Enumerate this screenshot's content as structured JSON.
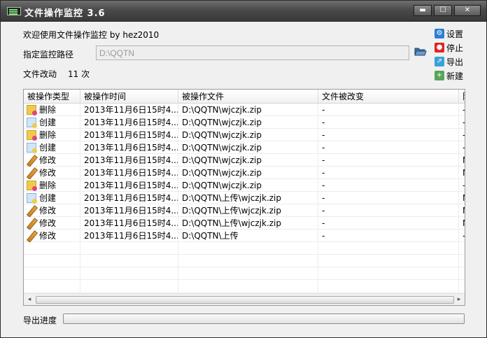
{
  "window": {
    "title": "文件操作监控 3.6",
    "minimize_glyph": "▬",
    "maximize_glyph": "☐",
    "close_glyph": "✕"
  },
  "welcome": "欢迎使用文件操作监控 by hez2010",
  "path": {
    "label": "指定监控路径",
    "value": "D:\\QQTN"
  },
  "count": {
    "label": "文件改动",
    "value": "11 次"
  },
  "side_buttons": [
    {
      "label": "设置",
      "icon": "gear-icon",
      "color": "#2d7fd3",
      "glyph": "⚙"
    },
    {
      "label": "停止",
      "icon": "stop-icon",
      "color": "#e02424",
      "glyph": "●"
    },
    {
      "label": "导出",
      "icon": "export-icon",
      "color": "#3aa0d9",
      "glyph": "⇗"
    },
    {
      "label": "新建",
      "icon": "new-file-icon",
      "color": "#5aa35a",
      "glyph": "+"
    }
  ],
  "table": {
    "columns": [
      "被操作类型",
      "被操作时间",
      "被操作文件",
      "文件被改变",
      "附"
    ],
    "rows": [
      {
        "type": "删除",
        "icon": "delete-icon",
        "time": "2013年11月6日15时4...",
        "file": "D:\\QQTN\\wjczjk.zip",
        "changed": "-",
        "extra": "-"
      },
      {
        "type": "创建",
        "icon": "create-icon",
        "time": "2013年11月6日15时4...",
        "file": "D:\\QQTN\\wjczjk.zip",
        "changed": "-",
        "extra": "-"
      },
      {
        "type": "删除",
        "icon": "delete-icon",
        "time": "2013年11月6日15时4...",
        "file": "D:\\QQTN\\wjczjk.zip",
        "changed": "-",
        "extra": "-"
      },
      {
        "type": "创建",
        "icon": "create-icon",
        "time": "2013年11月6日15时4...",
        "file": "D:\\QQTN\\wjczjk.zip",
        "changed": "-",
        "extra": "-"
      },
      {
        "type": "修改",
        "icon": "modify-icon",
        "time": "2013年11月6日15时4...",
        "file": "D:\\QQTN\\wjczjk.zip",
        "changed": "-",
        "extra": "N"
      },
      {
        "type": "修改",
        "icon": "modify-icon",
        "time": "2013年11月6日15时4...",
        "file": "D:\\QQTN\\wjczjk.zip",
        "changed": "-",
        "extra": "N"
      },
      {
        "type": "删除",
        "icon": "delete-icon",
        "time": "2013年11月6日15时4...",
        "file": "D:\\QQTN\\wjczjk.zip",
        "changed": "-",
        "extra": "-"
      },
      {
        "type": "创建",
        "icon": "create-icon",
        "time": "2013年11月6日15时4...",
        "file": "D:\\QQTN\\上传\\wjczjk.zip",
        "changed": "-",
        "extra": "N"
      },
      {
        "type": "修改",
        "icon": "modify-icon",
        "time": "2013年11月6日15时4...",
        "file": "D:\\QQTN\\上传\\wjczjk.zip",
        "changed": "-",
        "extra": "N"
      },
      {
        "type": "修改",
        "icon": "modify-icon",
        "time": "2013年11月6日15时4...",
        "file": "D:\\QQTN\\上传\\wjczjk.zip",
        "changed": "-",
        "extra": "N"
      },
      {
        "type": "修改",
        "icon": "modify-icon",
        "time": "2013年11月6日15时4...",
        "file": "D:\\QQTN\\上传",
        "changed": "-",
        "extra": "-"
      }
    ]
  },
  "scroll": {
    "left_glyph": "◂",
    "right_glyph": "▸"
  },
  "export_progress": {
    "label": "导出进度",
    "percent": 0
  }
}
